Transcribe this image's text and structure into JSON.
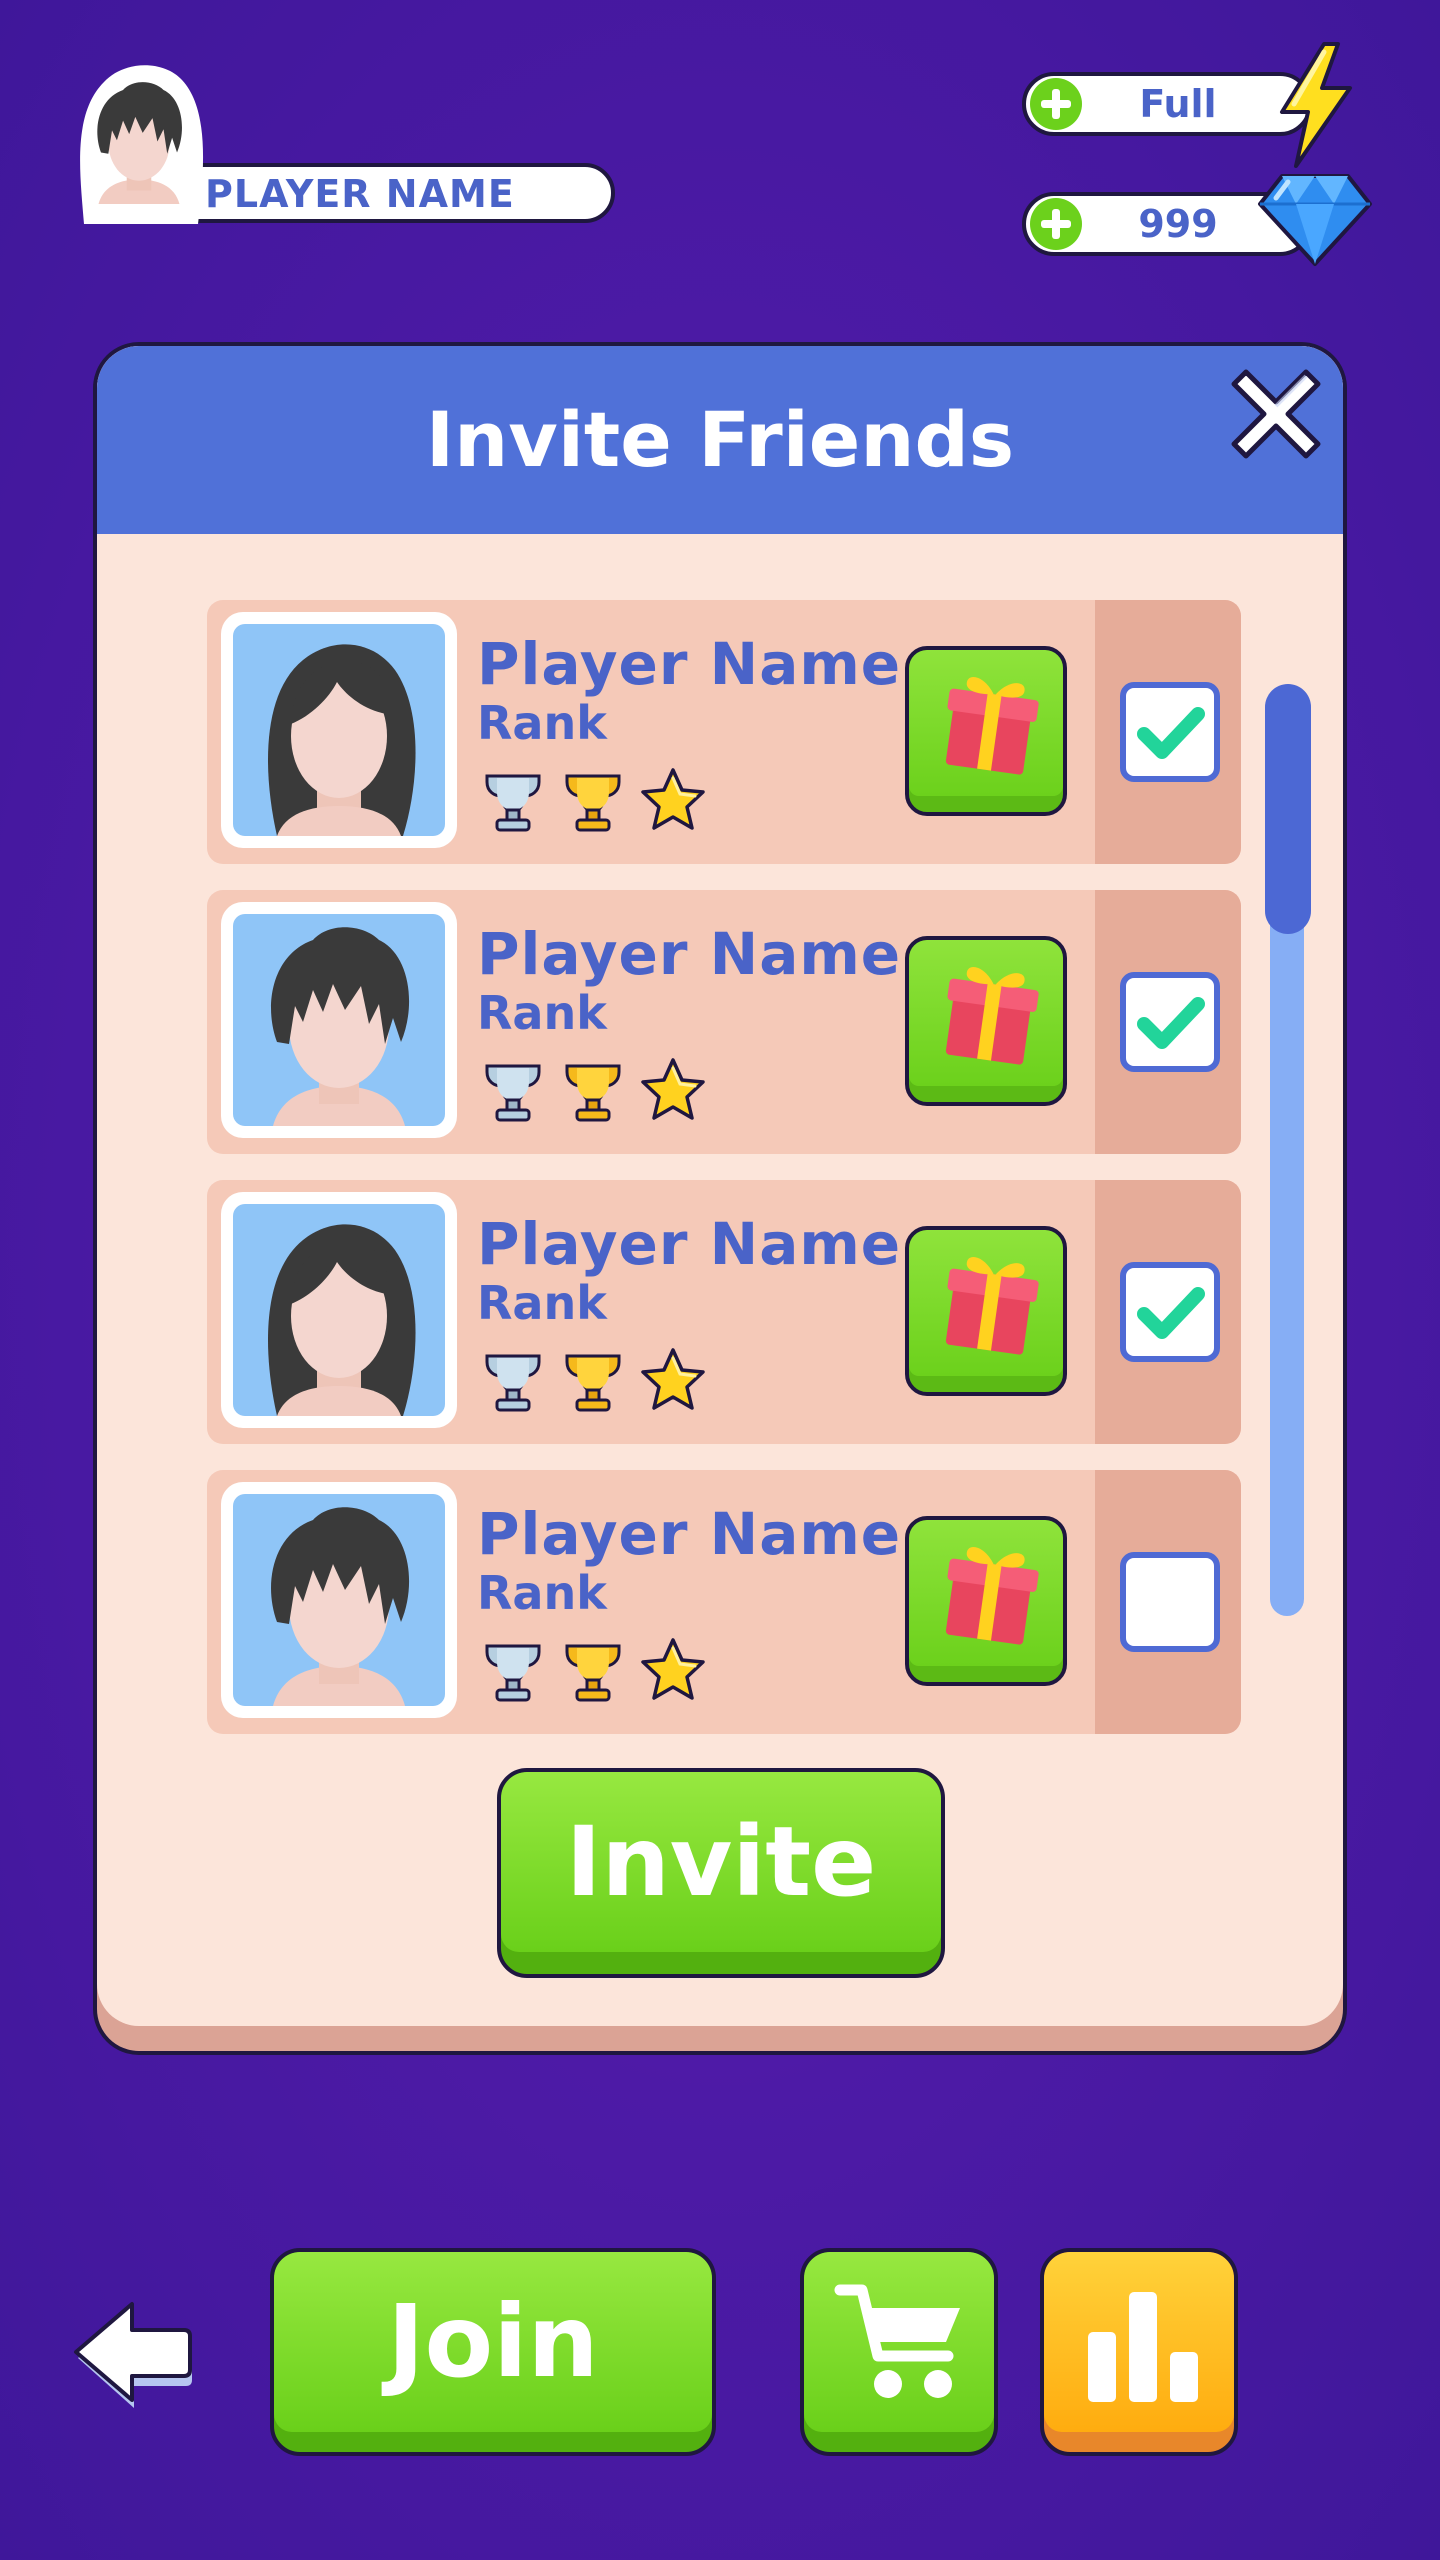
{
  "player": {
    "name": "PLAYER NAME"
  },
  "currency": {
    "energy": {
      "value": "Full",
      "icon": "lightning-icon"
    },
    "gems": {
      "value": "999",
      "icon": "gem-icon"
    }
  },
  "dialog": {
    "title": "Invite Friends",
    "invite_label": "Invite",
    "rows": [
      {
        "name": "Player Name",
        "rank": "Rank",
        "avatar": "female",
        "checked": true
      },
      {
        "name": "Player Name",
        "rank": "Rank",
        "avatar": "male",
        "checked": true
      },
      {
        "name": "Player Name",
        "rank": "Rank",
        "avatar": "female",
        "checked": true
      },
      {
        "name": "Player Name",
        "rank": "Rank",
        "avatar": "male",
        "checked": false
      }
    ]
  },
  "bottom_nav": {
    "join_label": "Join",
    "icons": [
      "back-arrow-icon",
      "cart-icon",
      "leaderboard-icon"
    ]
  },
  "colors": {
    "background": "#4d1aa6",
    "header": "#5071d8",
    "panel": "#fce5da",
    "text_blue": "#4a63c8",
    "green": "#6ad01a",
    "orange": "#ffac0f"
  }
}
